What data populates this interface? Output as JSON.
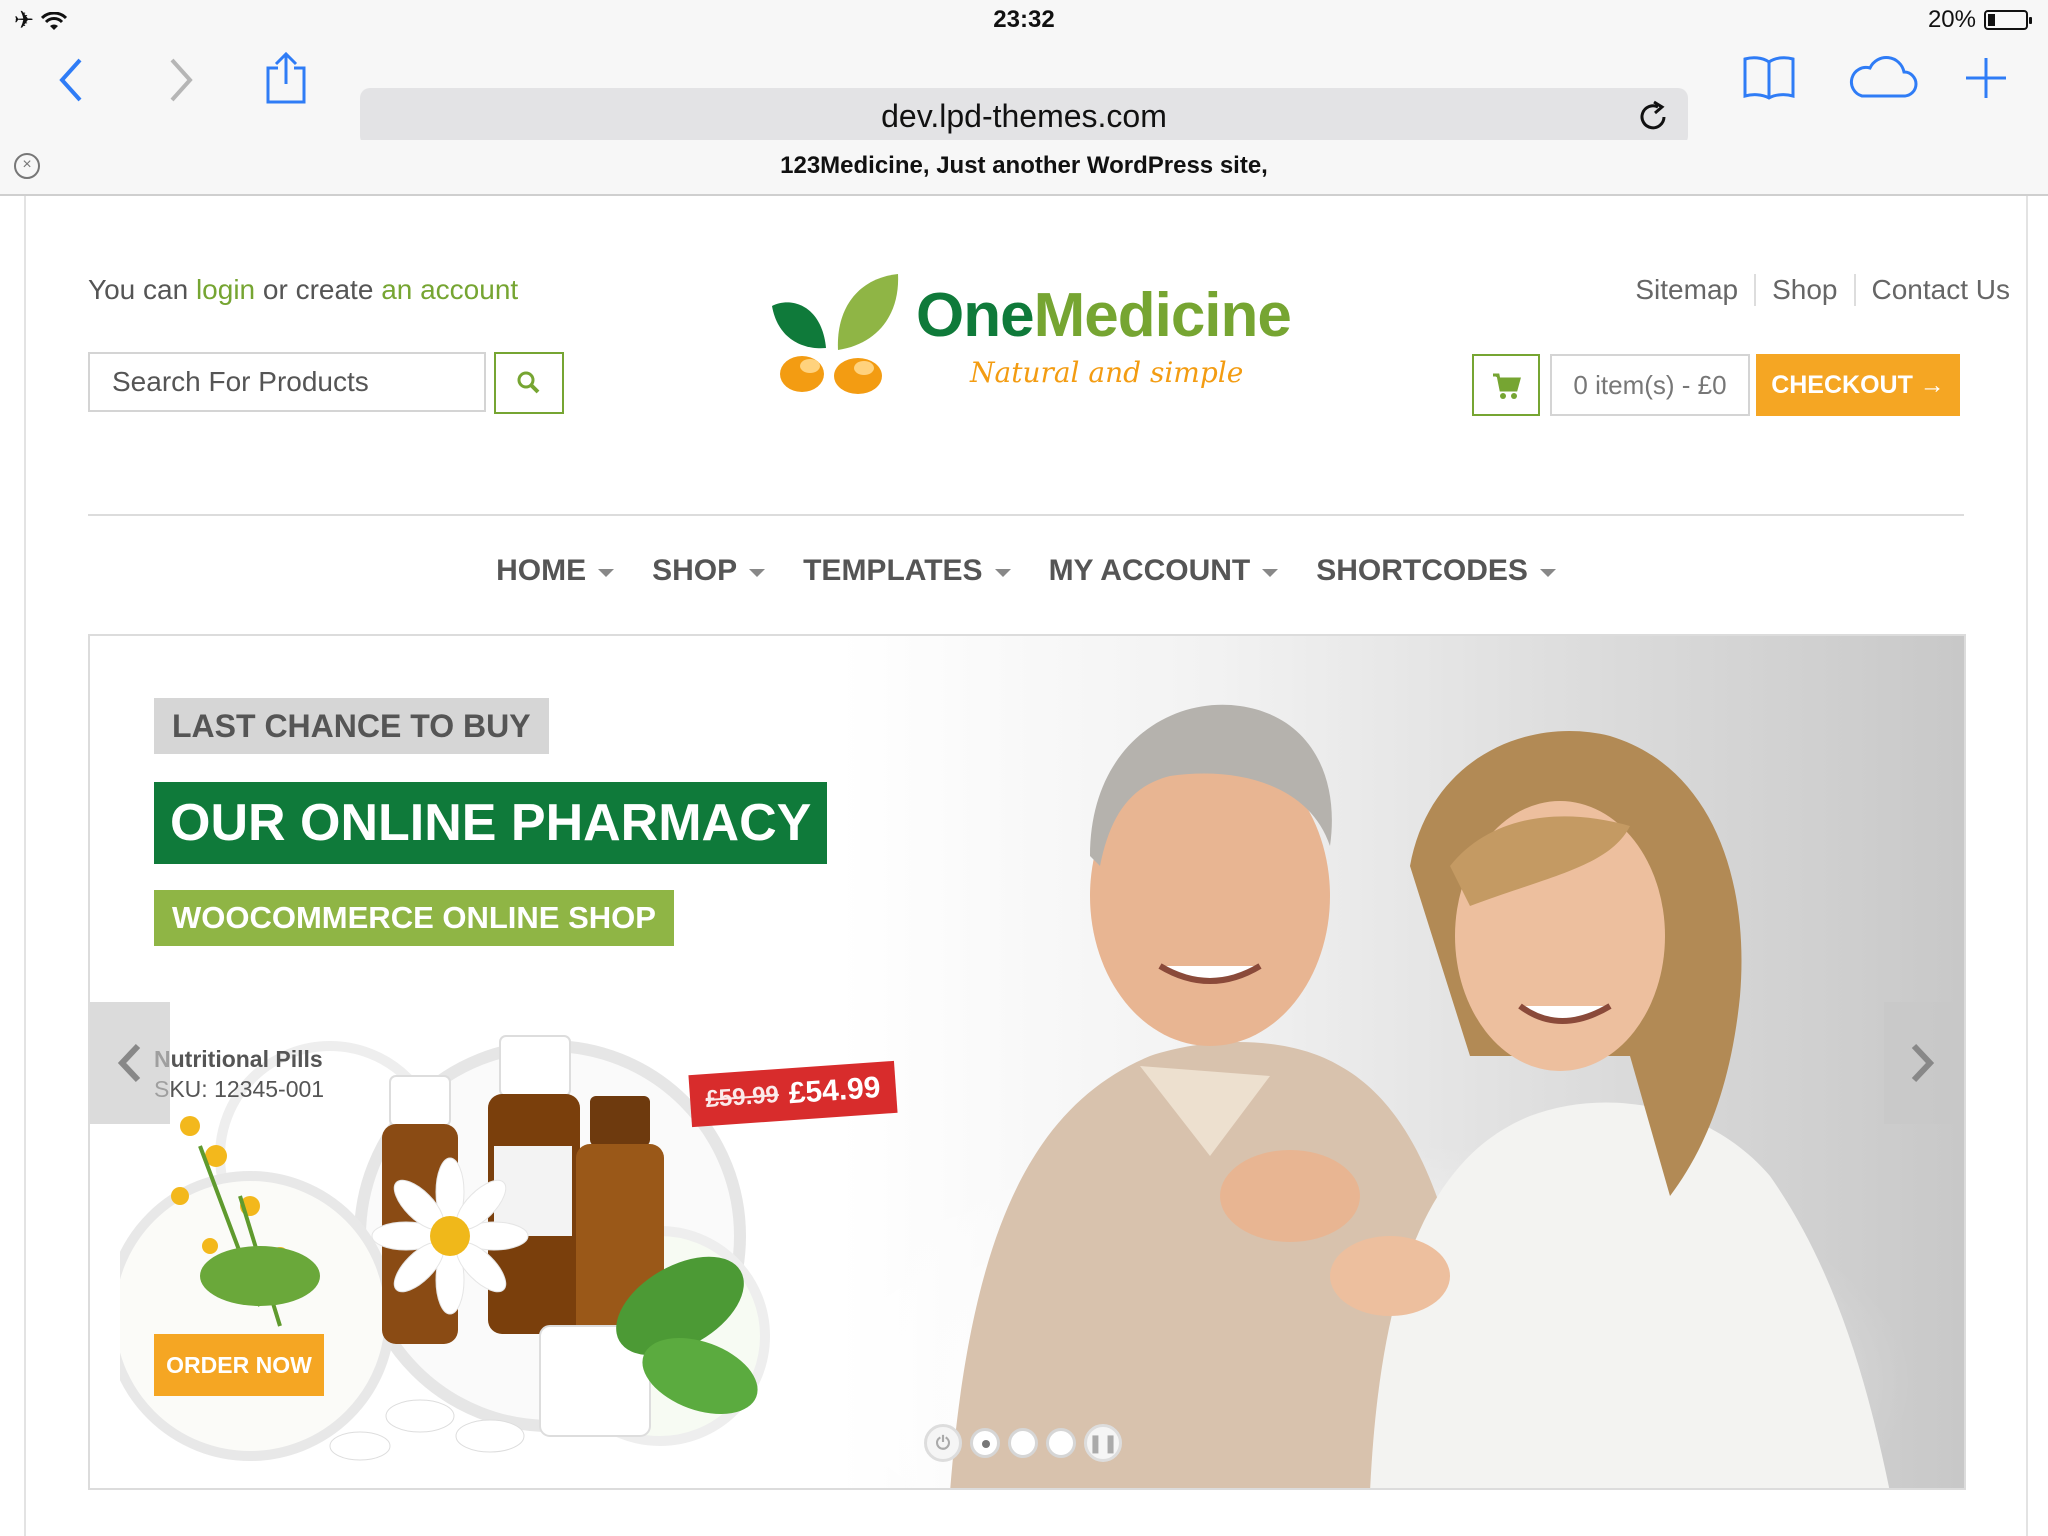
{
  "status_bar": {
    "time": "23:32",
    "battery": "20%",
    "battery_level": 0.2
  },
  "browser": {
    "url": "dev.lpd-themes.com",
    "tab_title": "123Medicine, Just another WordPress site,",
    "icons": [
      "back-icon",
      "forward-icon",
      "share-icon",
      "reload-icon",
      "bookmarks-icon",
      "cloud-tabs-icon",
      "new-tab-icon",
      "close-tab-icon"
    ]
  },
  "header": {
    "account_prefix": "You can ",
    "login_link": "login",
    "account_mid": " or create ",
    "account_link": "an account",
    "search_placeholder": "Search For Products",
    "logo_one": "One",
    "logo_medicine": "Medicine",
    "logo_tagline": "Natural and simple",
    "top_links": [
      "Sitemap",
      "Shop",
      "Contact Us"
    ],
    "cart_text": "0 item(s) - £0",
    "checkout_label": "CHECKOUT →"
  },
  "nav": [
    "HOME",
    "SHOP",
    "TEMPLATES",
    "MY ACCOUNT",
    "SHORTCODES"
  ],
  "slider": {
    "tag_1": "LAST CHANCE TO BUY",
    "tag_2": "OUR ONLINE PHARMACY",
    "tag_3": "WOOCOMMERCE ONLINE SHOP",
    "product_name": "Nutritional Pills",
    "product_sku": "SKU: 12345-001",
    "price_old": "£59.99",
    "price_new": "£54.99",
    "order_label": "ORDER NOW",
    "active_slide": 1,
    "slide_count": 3
  },
  "colors": {
    "green_dark": "#0f7a3a",
    "green_light": "#76a532",
    "orange": "#f5a623",
    "ios_blue": "#2f7cf6",
    "price_red": "#d82c2c"
  }
}
